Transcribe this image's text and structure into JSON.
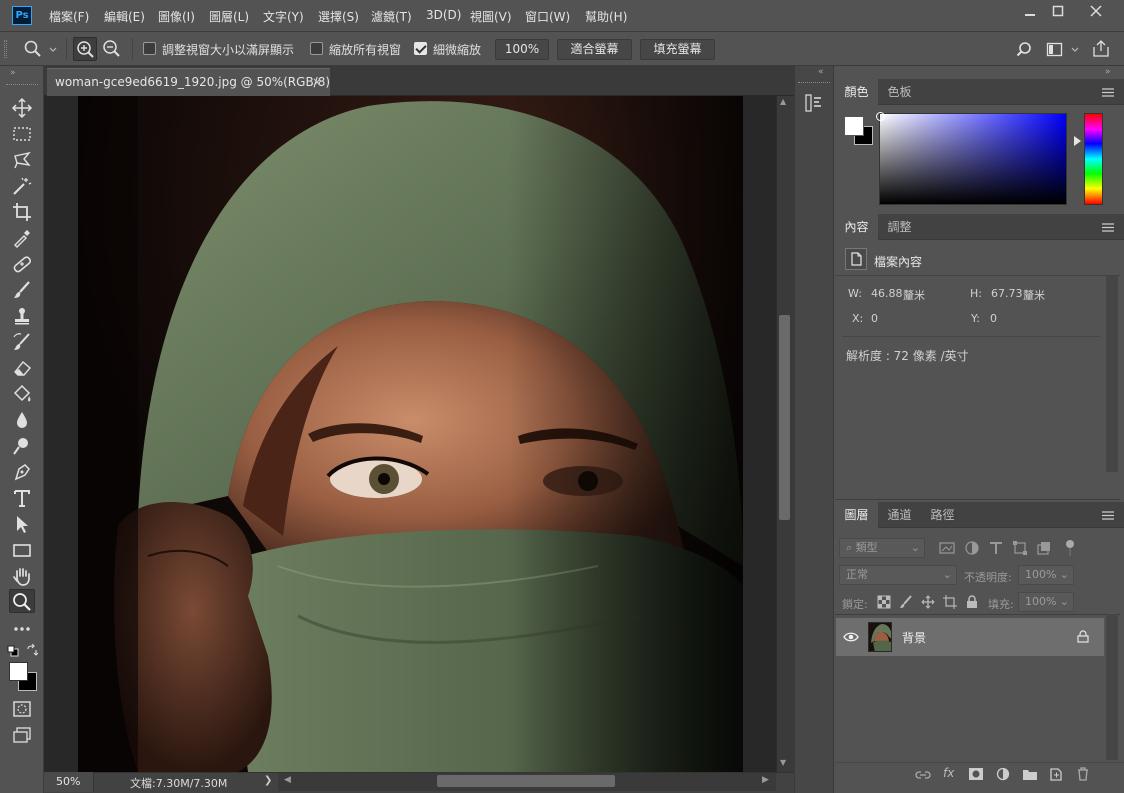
{
  "app": {
    "logo_text": "Ps"
  },
  "menu": [
    "檔案(F)",
    "編輯(E)",
    "圖像(I)",
    "圖層(L)",
    "文字(Y)",
    "選擇(S)",
    "濾鏡(T)",
    "3D(D)",
    "視圖(V)",
    "窗口(W)",
    "幫助(H)"
  ],
  "options": {
    "resize_windows_label": "調整視窗大小以滿屏顯示",
    "zoom_all_label": "縮放所有視窗",
    "scrubby_zoom_label": "細微縮放",
    "zoom_value": "100%",
    "fit_screen_label": "適合螢幕",
    "fill_screen_label": "填充螢幕",
    "resize_windows_checked": false,
    "zoom_all_checked": false,
    "scrubby_zoom_checked": true
  },
  "document": {
    "tab_title": "woman-gce9ed6619_1920.jpg @ 50%(RGB/8)",
    "close_glyph": "×"
  },
  "status": {
    "zoom": "50%",
    "doc_info": "文檔:7.30M/7.30M",
    "arrow": "❯"
  },
  "color_panel": {
    "tabs": [
      "顏色",
      "色板"
    ],
    "hue_color": "#0000ff"
  },
  "properties_panel": {
    "tabs": [
      "內容",
      "調整"
    ],
    "doc_label": "檔案內容",
    "w_label": "W:",
    "w_value": "46.88",
    "w_unit": "釐米",
    "h_label": "H:",
    "h_value": "67.73",
    "h_unit": "釐米",
    "x_label": "X:",
    "x_value": "0",
    "y_label": "Y:",
    "y_value": "0",
    "resolution": "解析度 : 72 像素 /英寸"
  },
  "layers_panel": {
    "tabs": [
      "圖層",
      "通道",
      "路徑"
    ],
    "filter_kind": "類型",
    "blend_mode": "正常",
    "opacity_label": "不透明度:",
    "opacity_value": "100%",
    "lock_label": "鎖定:",
    "fill_label": "填充:",
    "fill_value": "100%",
    "layers": [
      {
        "name": "背景",
        "locked": true,
        "visible": true
      }
    ]
  },
  "colors": {
    "accent": "#31a8ff",
    "foreground": "#ffffff",
    "background": "#000000"
  }
}
